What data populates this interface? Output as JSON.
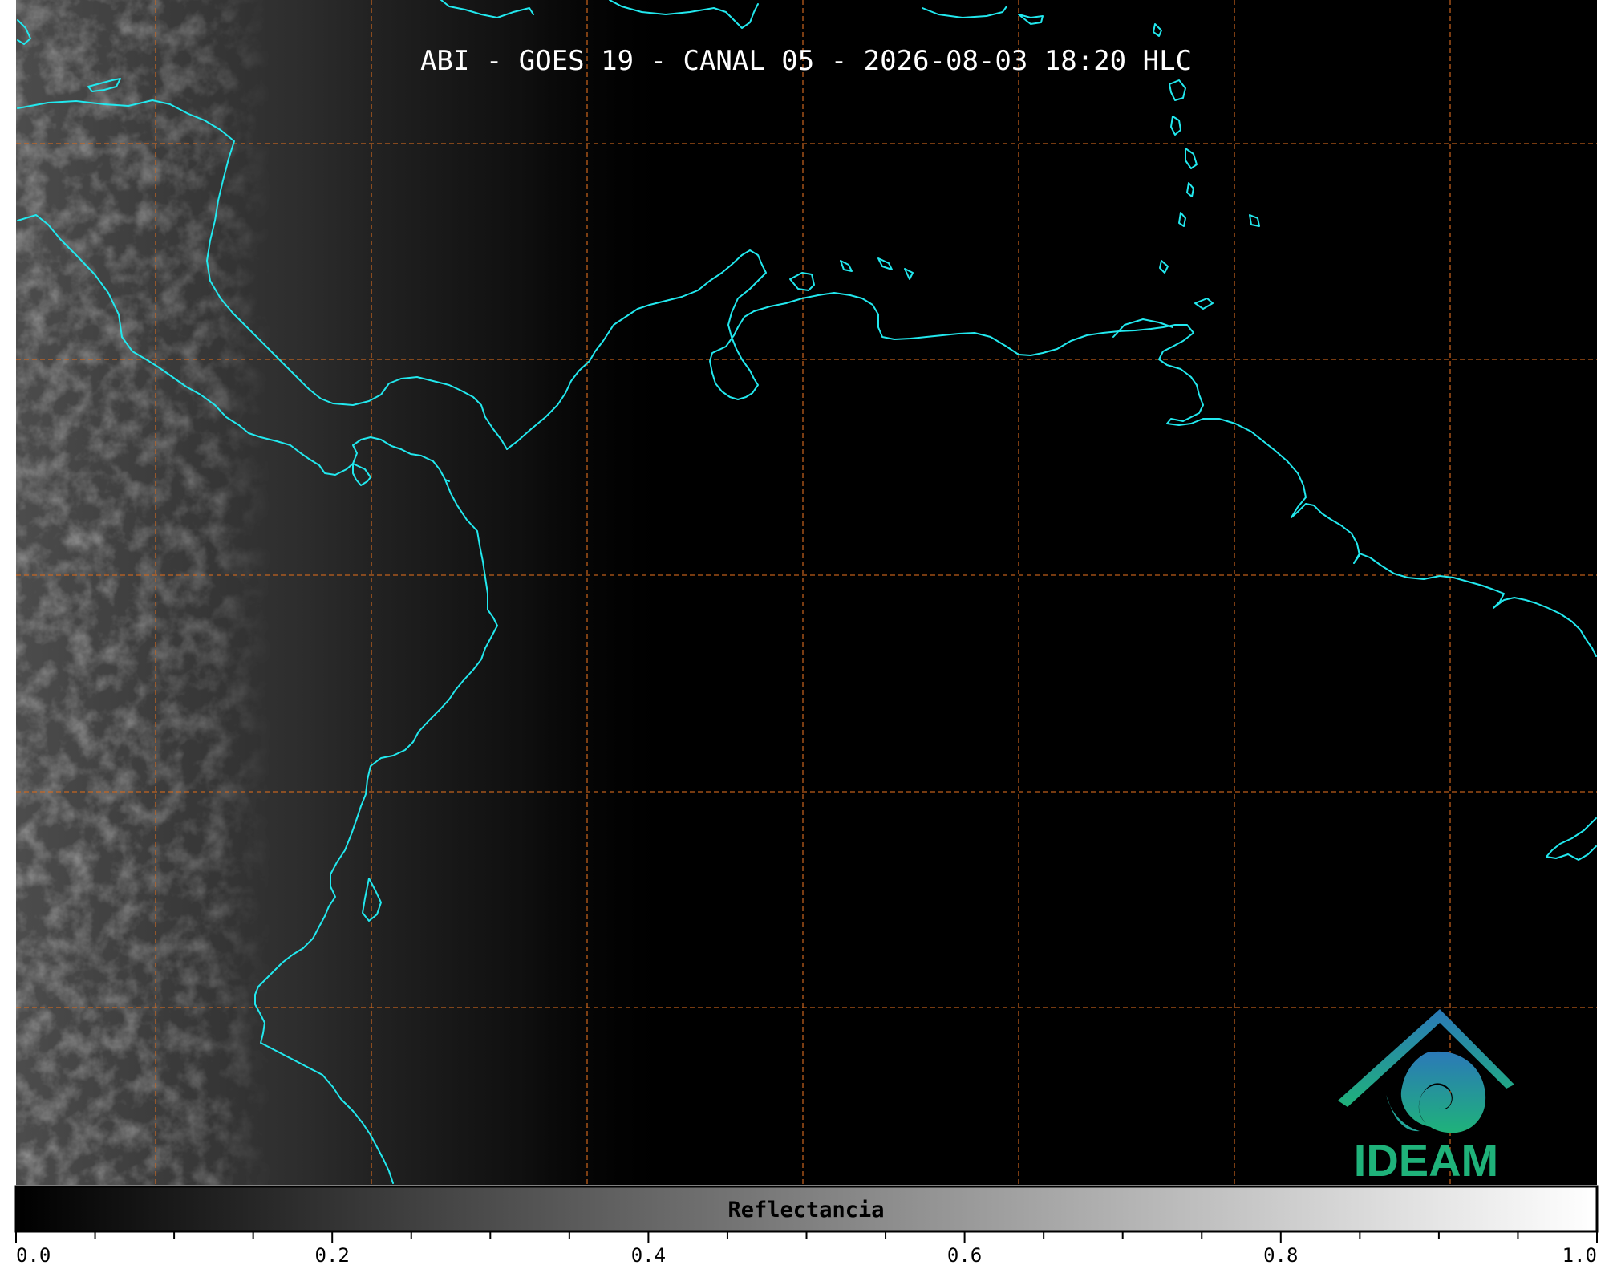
{
  "title": "ABI - GOES 19 - CANAL 05 - 2026-08-03 18:20 HLC",
  "logo": {
    "text": "IDEAM",
    "icon": "ideam-mountain-swirl-logo",
    "colors": {
      "top": "#2b79b8",
      "bottom": "#1fb27a"
    }
  },
  "map": {
    "background": "#000000",
    "coastline_color": "#22e8ee",
    "grid_color": "#d2691e"
  },
  "colorbar": {
    "label": "Reflectancia",
    "min": 0.0,
    "max": 1.0,
    "tick_labels": [
      "0.0",
      "0.2",
      "0.4",
      "0.6",
      "0.8",
      "1.0"
    ],
    "tick_values": [
      0.0,
      0.2,
      0.4,
      0.6,
      0.8,
      1.0
    ],
    "minor_tick_values": [
      0.05,
      0.1,
      0.15,
      0.25,
      0.3,
      0.35,
      0.45,
      0.5,
      0.55,
      0.65,
      0.7,
      0.75,
      0.85,
      0.9,
      0.95
    ],
    "color_start": "#000000",
    "color_end": "#ffffff"
  }
}
